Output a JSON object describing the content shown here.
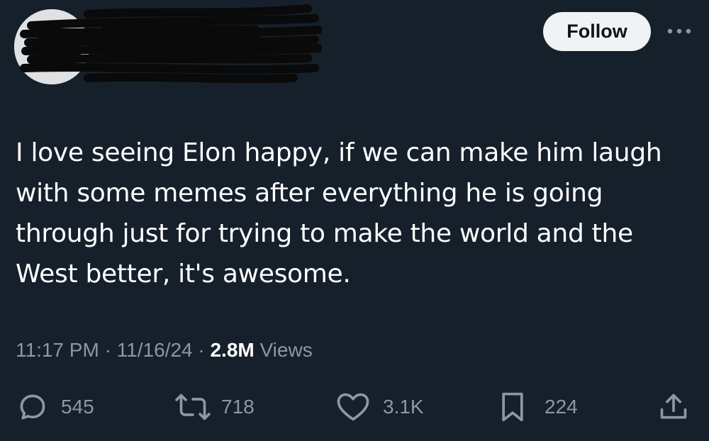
{
  "header": {
    "follow_label": "Follow"
  },
  "tweet": {
    "text": "I love seeing Elon happy, if we can make him laugh\nwith some memes after everything he is going\nthrough just for trying to make the world and the\nWest better, it's awesome.",
    "time": "11:17 PM",
    "date": "11/16/24",
    "separator": "·",
    "views_count": "2.8M",
    "views_label": "Views"
  },
  "actions": {
    "replies": "545",
    "reposts": "718",
    "likes": "3.1K",
    "bookmarks": "224"
  },
  "colors": {
    "background": "#15202b",
    "secondary_text": "#8b98a5",
    "follow_button_bg": "#eff3f4"
  },
  "icons": {
    "more": "more-horizontal-icon",
    "reply": "reply-icon",
    "repost": "repost-icon",
    "like": "heart-icon",
    "bookmark": "bookmark-icon",
    "share": "share-icon"
  }
}
